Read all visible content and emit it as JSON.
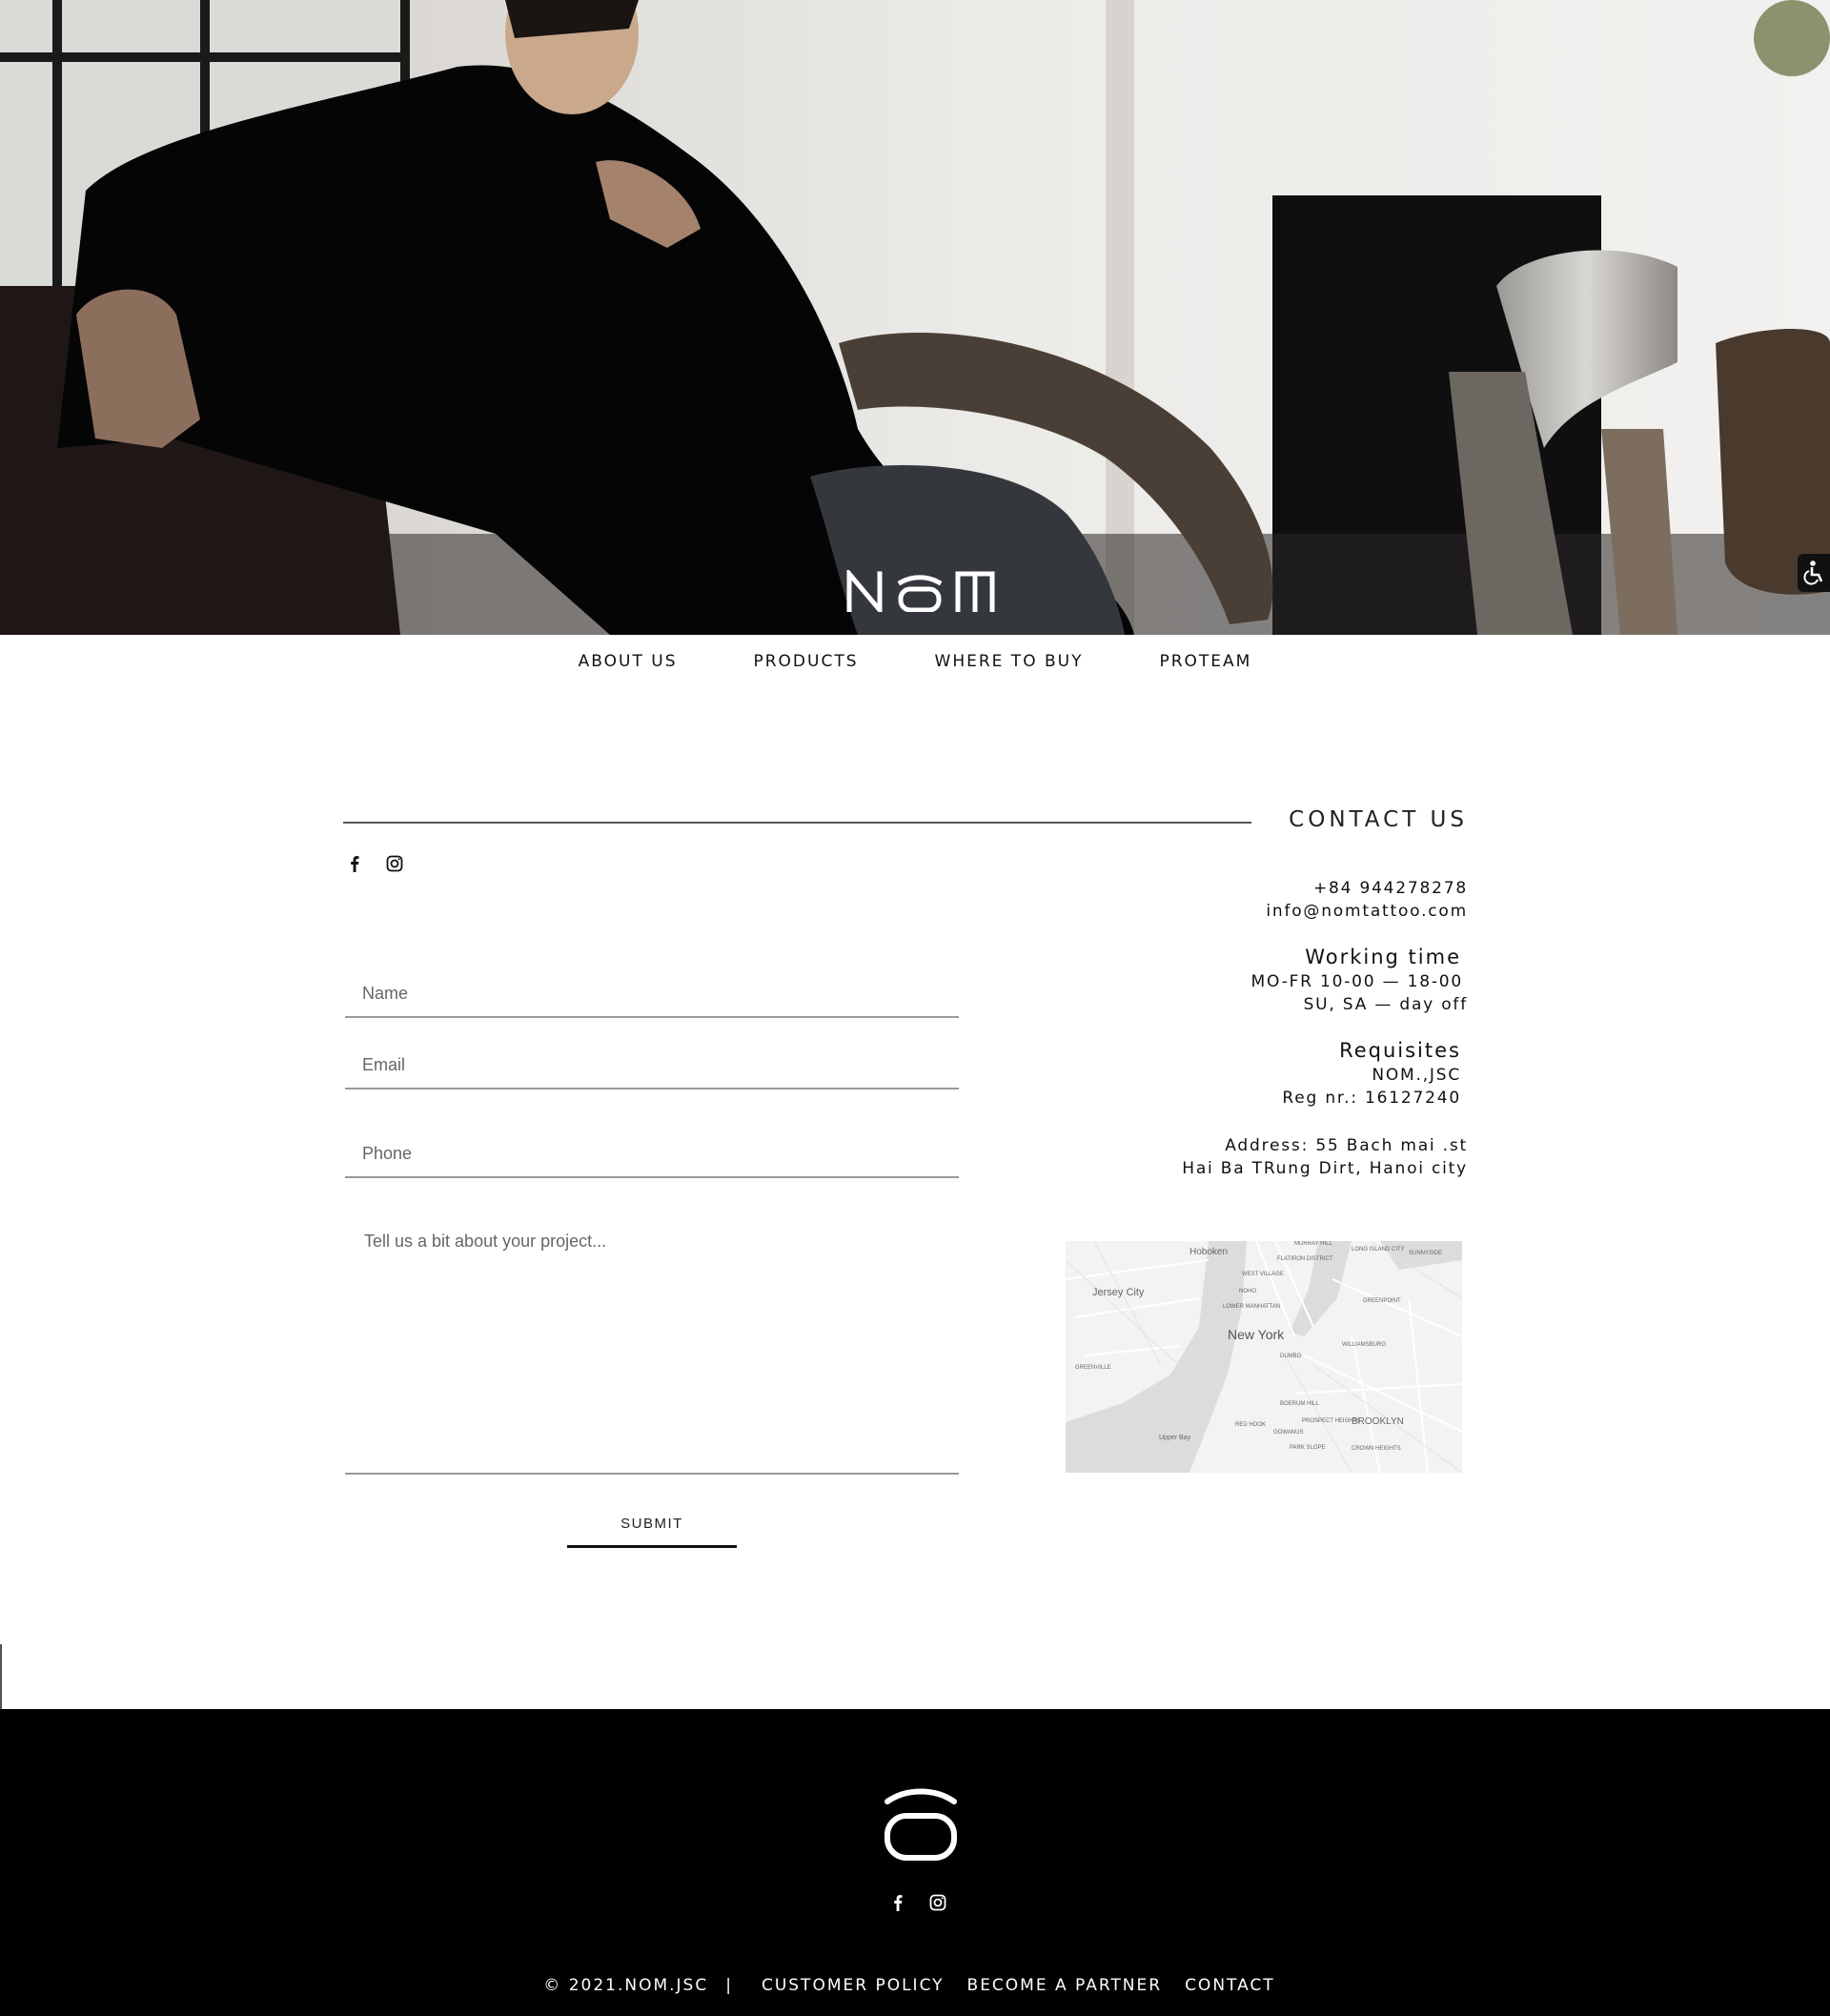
{
  "brand": {
    "logo_text": "NoM"
  },
  "nav": {
    "items": [
      {
        "label": "ABOUT US"
      },
      {
        "label": "PRODUCTS"
      },
      {
        "label": "WHERE TO BUY"
      },
      {
        "label": "PROTEAM"
      }
    ]
  },
  "contact": {
    "title": "CONTACT US",
    "phone": "+84 944278278",
    "email": "info@nomtattoo.com",
    "working_time_title": "Working time",
    "working_weekdays": "MO-FR  10-00 — 18-00",
    "working_weekend": "SU, SA — day off",
    "requisites_title": "Requisites",
    "company": "NOM.,JSC",
    "reg_number": "Reg nr.: 16127240",
    "address_line1": "Address: 55 Bach mai .st",
    "address_line2": "Hai Ba TRung Dirt, Hanoi city"
  },
  "form": {
    "name_placeholder": "Name",
    "email_placeholder": "Email",
    "phone_placeholder": "Phone",
    "message_placeholder": "Tell us a bit about your project...",
    "submit_label": "SUBMIT"
  },
  "map": {
    "labels": [
      "Hoboken",
      "Jersey City",
      "New York",
      "BROOKLYN",
      "Upper Bay",
      "NOHO",
      "WILLIAMSBURG",
      "GREENPOINT",
      "DUMBO",
      "RED HOOK",
      "PARK SLOPE",
      "GREENVILLE",
      "LONG ISLAND CITY",
      "SUNNYSIDE",
      "MURRAY HILL",
      "FLATIRON DISTRICT",
      "WEST VILLAGE",
      "LOWER MANHATTAN",
      "CROWN HEIGHTS",
      "BOERUM HILL",
      "GOWANUS",
      "PROSPECT HEIGHTS"
    ]
  },
  "footer": {
    "copyright": "© 2021.NOM.JSC",
    "separator": "|",
    "links": [
      {
        "label": "CUSTOMER POLICY"
      },
      {
        "label": "BECOME A PARTNER"
      },
      {
        "label": "CONTACT"
      }
    ]
  },
  "icons": {
    "facebook": "facebook-icon",
    "instagram": "instagram-icon",
    "accessibility": "accessibility-icon"
  },
  "colors": {
    "footer_bg": "#000000",
    "text": "#111111",
    "rule": "#999999"
  }
}
